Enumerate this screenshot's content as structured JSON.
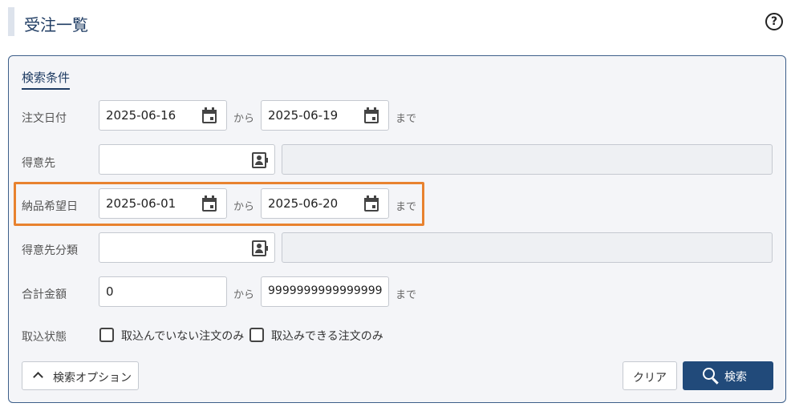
{
  "page": {
    "title": "受注一覧"
  },
  "search": {
    "panel_title": "検索条件",
    "order_date": {
      "label": "注文日付",
      "from": "2025-06-16",
      "to": "2025-06-19",
      "from_sep": "から",
      "to_sep": "まで"
    },
    "customer": {
      "label": "得意先",
      "code": "",
      "name": ""
    },
    "delivery_date": {
      "label": "納品希望日",
      "from": "2025-06-01",
      "to": "2025-06-20",
      "from_sep": "から",
      "to_sep": "まで"
    },
    "customer_category": {
      "label": "得意先分類",
      "code": "",
      "name": ""
    },
    "total_amount": {
      "label": "合計金額",
      "from": "0",
      "to": "9999999999999999",
      "from_sep": "から",
      "to_sep": "まで"
    },
    "import_status": {
      "label": "取込状態",
      "options": [
        {
          "label": "取込んでいない注文のみ",
          "checked": false
        },
        {
          "label": "取込みできる注文のみ",
          "checked": false
        }
      ]
    },
    "buttons": {
      "options": "検索オプション",
      "clear": "クリア",
      "search": "検索"
    }
  },
  "colors": {
    "accent": "#214a7a",
    "highlight": "#e8822f",
    "panel_bg": "#f4f5f8"
  }
}
